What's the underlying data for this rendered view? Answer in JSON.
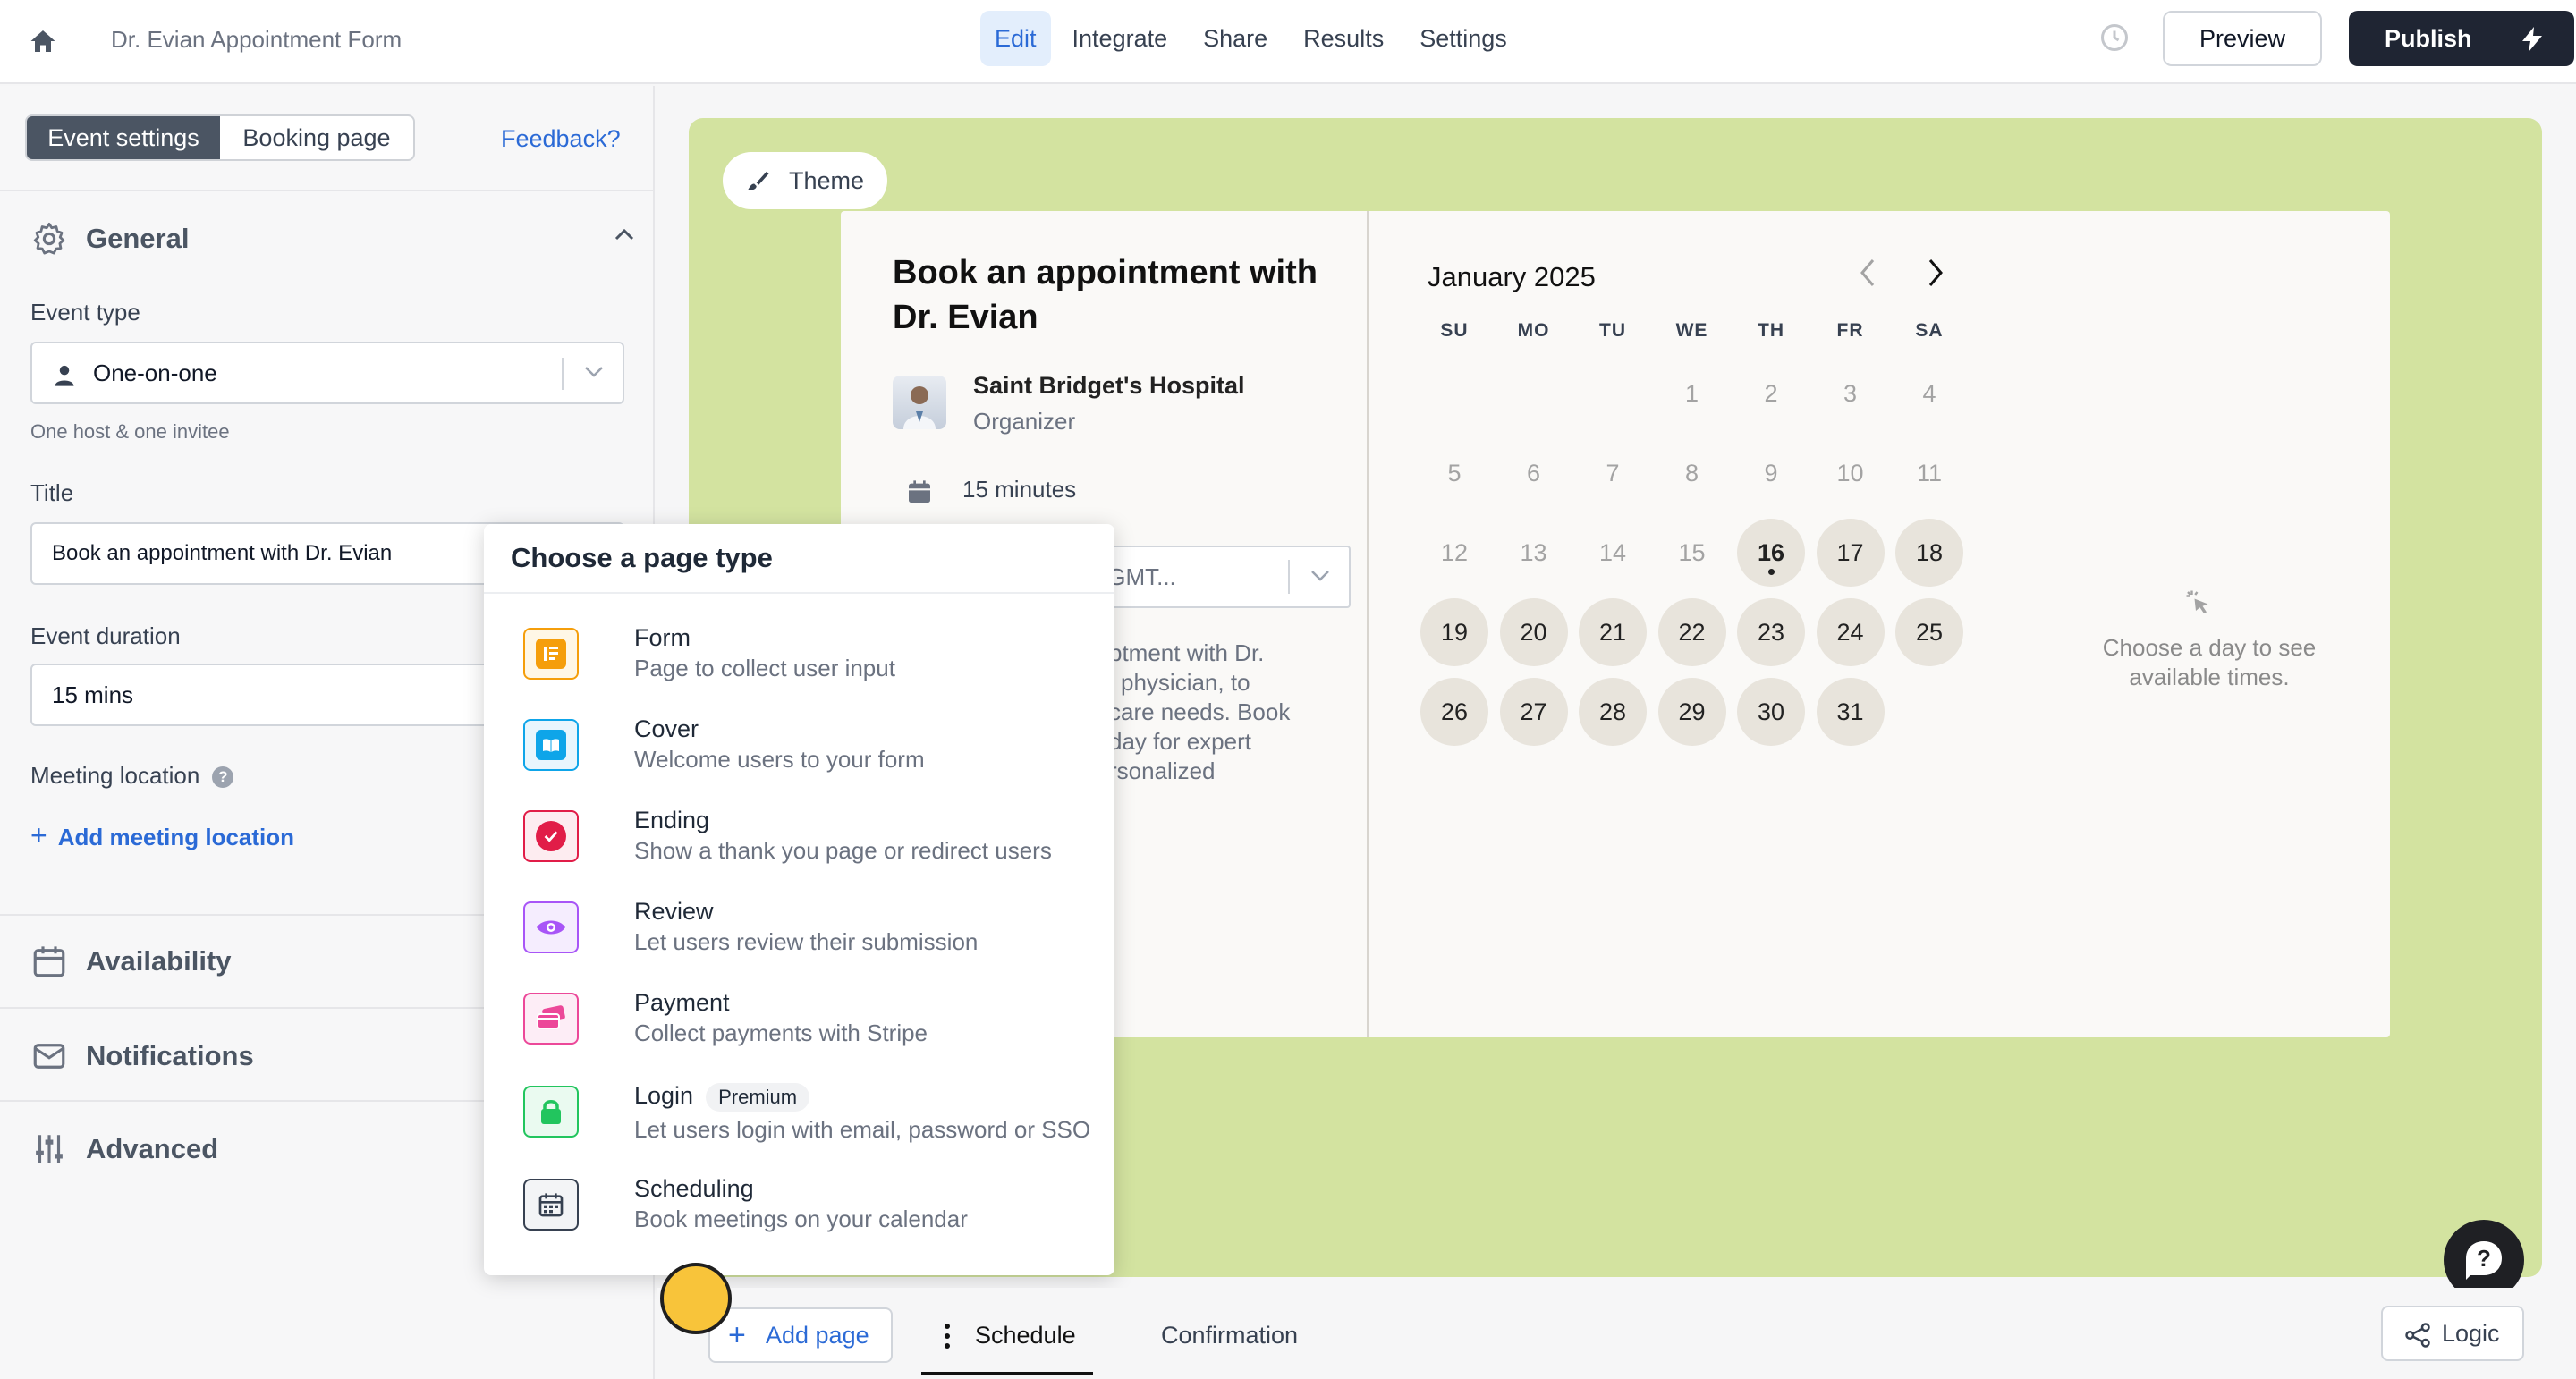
{
  "header": {
    "form_title": "Dr. Evian Appointment Form",
    "tabs": [
      "Edit",
      "Integrate",
      "Share",
      "Results",
      "Settings"
    ],
    "active_tab": "Edit",
    "preview_label": "Preview",
    "publish_label": "Publish"
  },
  "sidebar": {
    "segments": [
      "Event settings",
      "Booking page"
    ],
    "active_segment": "Event settings",
    "feedback_label": "Feedback?",
    "general": {
      "title": "General",
      "event_type_label": "Event type",
      "event_type_value": "One-on-one",
      "event_type_hint": "One host & one invitee",
      "title_label": "Title",
      "title_value": "Book an appointment with Dr. Evian",
      "duration_label": "Event duration",
      "duration_value": "15 mins",
      "location_label": "Meeting location",
      "add_location_label": "Add meeting location"
    },
    "sections": [
      "Availability",
      "Notifications",
      "Advanced"
    ]
  },
  "canvas": {
    "bg_color": "#d3e3a0",
    "theme_label": "Theme",
    "booking": {
      "title": "Book an appointment with Dr. Evian",
      "organizer_name": "Saint Bridget's Hospital",
      "organizer_role": "Organizer",
      "duration": "15 minutes",
      "timezone_partial": "ter (GMT...",
      "description_lines": [
        "ptment with Dr.",
        "l physician, to",
        "care needs. Book",
        "day for expert",
        "rsonalized"
      ]
    },
    "calendar": {
      "month": "January 2025",
      "weekdays": [
        "SU",
        "MO",
        "TU",
        "WE",
        "TH",
        "FR",
        "SA"
      ],
      "first_weekday_index": 3,
      "days_in_month": 31,
      "today": 16,
      "available_from": 16,
      "choose_day_text": "Choose a day to see available times."
    }
  },
  "page_type_popup": {
    "title": "Choose a page type",
    "options": [
      {
        "name": "Form",
        "desc": "Page to collect user input",
        "icon": "form-icon",
        "color": "#f59e0b"
      },
      {
        "name": "Cover",
        "desc": "Welcome users to your form",
        "icon": "book-icon",
        "color": "#0ea5e9"
      },
      {
        "name": "Ending",
        "desc": "Show a thank you page or redirect users",
        "icon": "check-circle-icon",
        "color": "#e11d48"
      },
      {
        "name": "Review",
        "desc": "Let users review their submission",
        "icon": "eye-icon",
        "color": "#a855f7"
      },
      {
        "name": "Payment",
        "desc": "Collect payments with Stripe",
        "icon": "card-icon",
        "color": "#ec4899"
      },
      {
        "name": "Login",
        "desc": "Let users login with email, password or SSO",
        "icon": "lock-icon",
        "color": "#22c55e",
        "badge": "Premium"
      },
      {
        "name": "Scheduling",
        "desc": "Book meetings on your calendar",
        "icon": "calendar-icon",
        "color": "#374151"
      }
    ]
  },
  "bottom": {
    "add_page_label": "Add page",
    "tabs": [
      "Schedule",
      "Confirmation"
    ],
    "active_tab": "Schedule",
    "logic_label": "Logic"
  }
}
